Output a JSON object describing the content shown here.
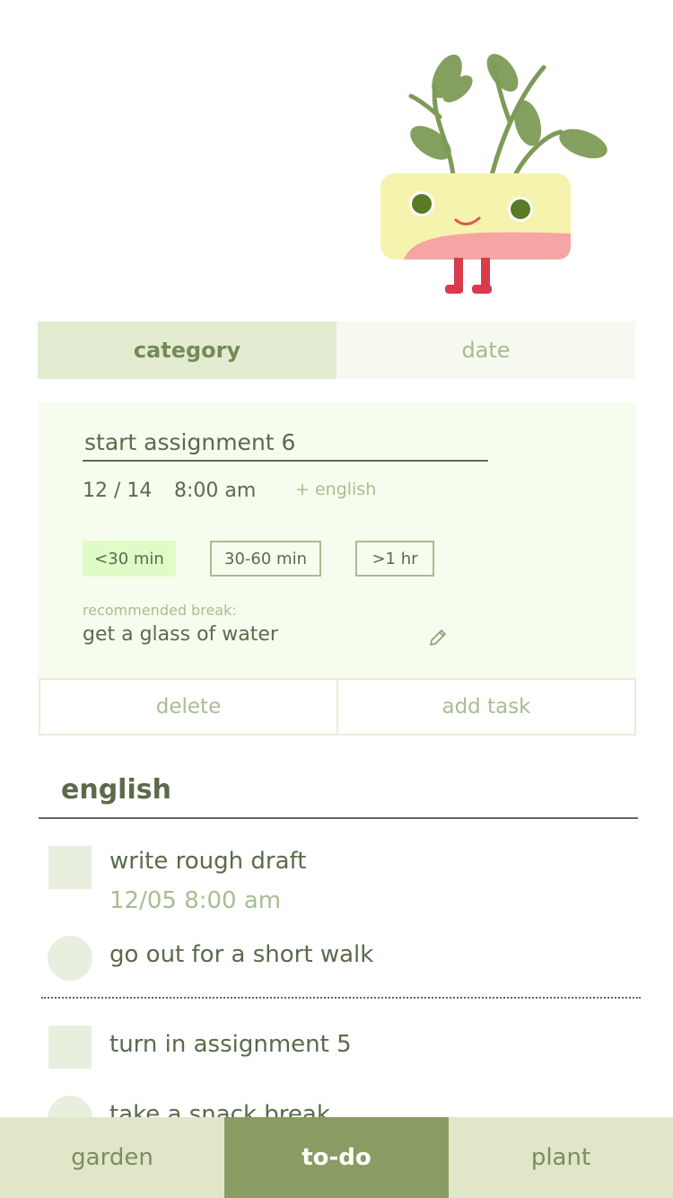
{
  "segment": {
    "category_label": "category",
    "date_label": "date",
    "selected": "category"
  },
  "task_form": {
    "title_value": "start assignment 6",
    "date": "12 / 14",
    "time": "8:00 am",
    "add_category": "+ english",
    "durations": [
      {
        "label": "<30 min",
        "selected": true
      },
      {
        "label": "30-60 min",
        "selected": false
      },
      {
        "label": ">1 hr",
        "selected": false
      }
    ],
    "recommended_label": "recommended break:",
    "recommended_value": "get a glass of water",
    "edit_icon": "pencil-icon"
  },
  "actions": {
    "delete_label": "delete",
    "add_label": "add task"
  },
  "category": {
    "heading": "english",
    "items": [
      {
        "type": "task",
        "text": "write rough draft",
        "date": "12/05 8:00 am"
      },
      {
        "type": "break",
        "text": "go out for a short walk"
      },
      {
        "type": "task",
        "text": "turn in assignment 5"
      },
      {
        "type": "break",
        "text": "take a snack break"
      }
    ]
  },
  "tabs": {
    "garden": "garden",
    "todo": "to-do",
    "plant": "plant",
    "active": "to-do"
  },
  "colors": {
    "accent": "#889c63",
    "text": "#5b6a4b",
    "muted": "#a9bd90",
    "card_bg": "#f7fdee",
    "selected_duration": "#dffcc6",
    "pot_yellow": "#f5f3ad",
    "pot_pink": "#f5a5a3",
    "leaf": "#7d9b56",
    "legs": "#d83c4a"
  }
}
